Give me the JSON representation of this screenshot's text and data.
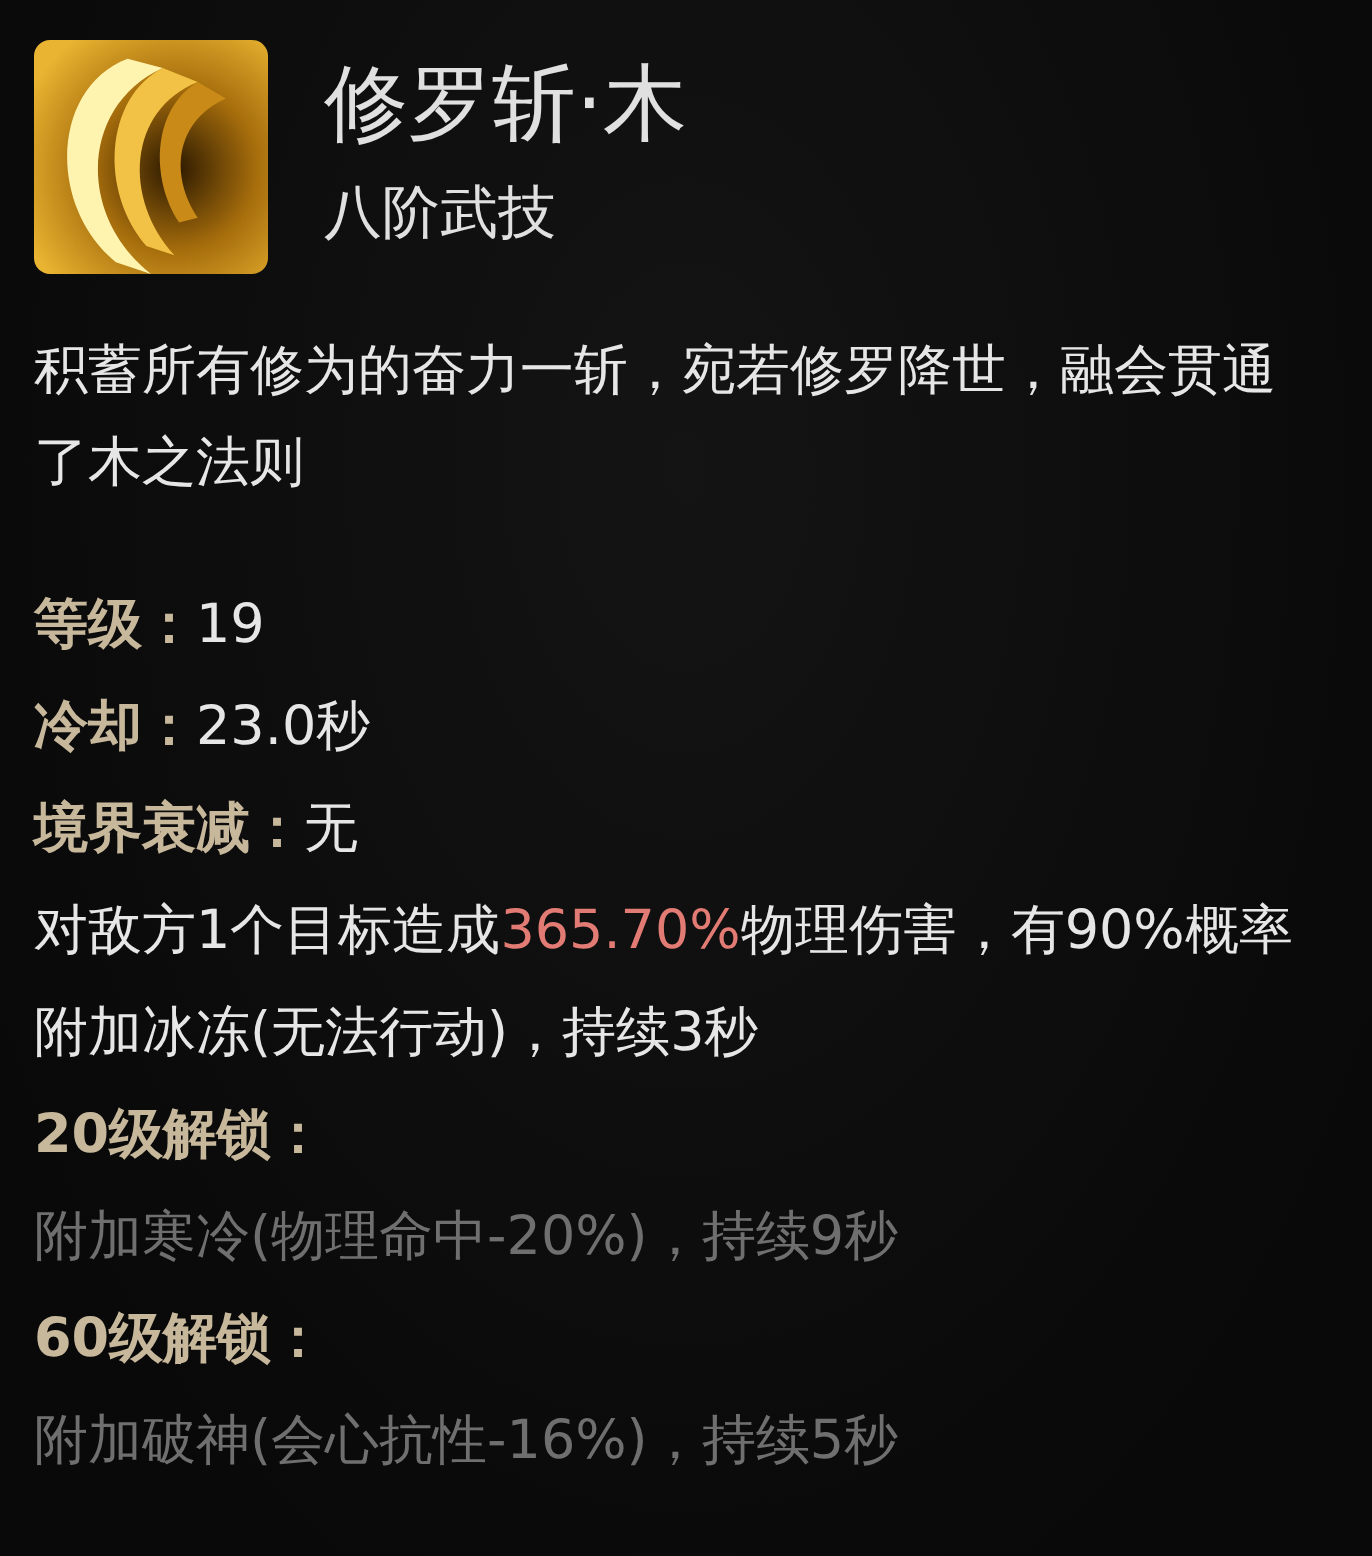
{
  "skill": {
    "name": "修罗斩·木",
    "rank": "八阶武技"
  },
  "description": "积蓄所有修为的奋力一斩，宛若修罗降世，融会贯通了木之法则",
  "stats": [
    {
      "label": "等级：",
      "value": "19"
    },
    {
      "label": "冷却：",
      "value": "23.0秒"
    },
    {
      "label": "境界衰减：",
      "value": "无"
    }
  ],
  "effect": [
    {
      "text": "对敌方1个目标造成",
      "highlight": false
    },
    {
      "text": "365.70%",
      "highlight": true
    },
    {
      "text": "物理伤害，有90%概率附加冰冻(无法行动)，持续3秒",
      "highlight": false
    }
  ],
  "unlocks": [
    {
      "title": "20级解锁：",
      "text": "附加寒冷(物理命中-20%)，持续9秒",
      "locked": true
    },
    {
      "title": "60级解锁：",
      "text": "附加破神(会心抗性-16%)，持续5秒",
      "locked": true
    }
  ]
}
